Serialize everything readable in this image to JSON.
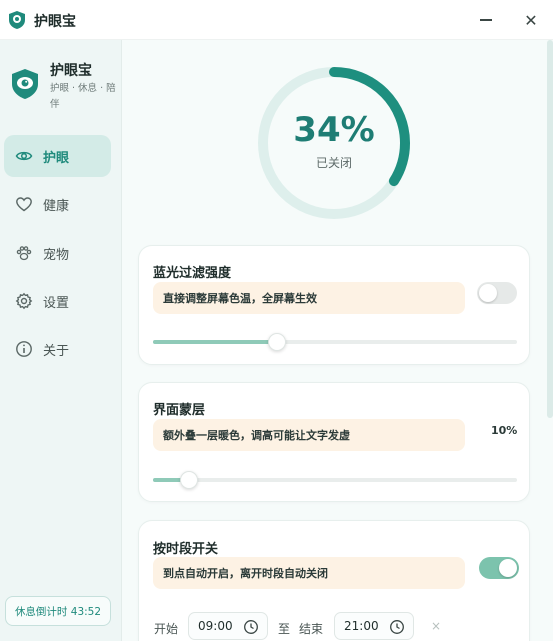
{
  "window": {
    "title": "护眼宝",
    "minimize_icon": "minimize-icon",
    "close_icon": "close-icon",
    "close_glyph": "✕"
  },
  "sidebar": {
    "brand_name": "护眼宝",
    "brand_tagline": "护眼 · 休息 · 陪伴",
    "items": [
      {
        "label": "护眼",
        "icon": "eye-icon",
        "active": true
      },
      {
        "label": "健康",
        "icon": "heart-icon",
        "active": false
      },
      {
        "label": "宠物",
        "icon": "paw-icon",
        "active": false
      },
      {
        "label": "设置",
        "icon": "gear-icon",
        "active": false
      },
      {
        "label": "关于",
        "icon": "info-icon",
        "active": false
      }
    ],
    "timer_text": "休息倒计时 43:52"
  },
  "ring": {
    "value": 34,
    "value_label": "34%",
    "status": "已关闭"
  },
  "cards": {
    "blue_light": {
      "title": "蓝光过滤强度",
      "hint": "直接调整屏幕色温，全屏幕生效",
      "toggle_on": false,
      "slider_value": 34
    },
    "overlay": {
      "title": "界面蒙层",
      "hint": "额外叠一层暖色，调高可能让文字发虚",
      "value_label": "10%",
      "slider_value": 10
    },
    "schedule": {
      "title": "按时段开关",
      "hint": "到点自动开启，离开时段自动关闭",
      "toggle_on": true,
      "start_label": "开始",
      "start_time": "09:00",
      "to_label": "至",
      "end_label": "结束",
      "end_time": "21:00",
      "clear_glyph": "×"
    }
  },
  "colors": {
    "accent": "#1e7d74",
    "ring_track": "#deefec",
    "hint_bg": "#fdf2e4",
    "slider_fill": "#8fcab8"
  }
}
